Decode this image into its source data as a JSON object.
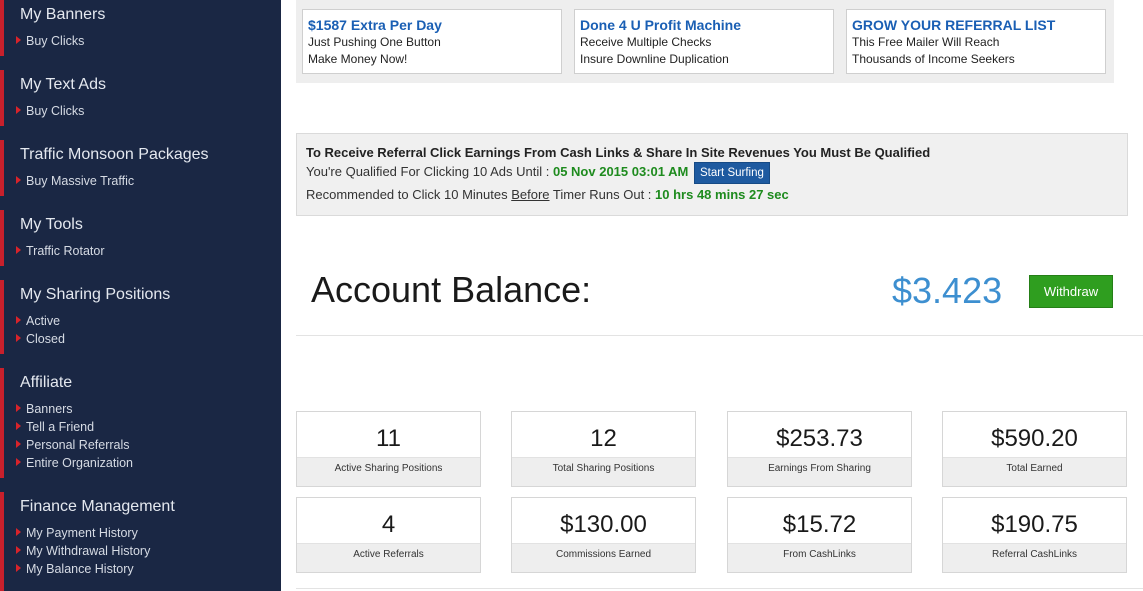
{
  "sidebar": {
    "sections": [
      {
        "title": "My Banners",
        "items": [
          "Buy Clicks"
        ]
      },
      {
        "title": "My Text Ads",
        "items": [
          "Buy Clicks"
        ]
      },
      {
        "title": "Traffic Monsoon Packages",
        "items": [
          "Buy Massive Traffic"
        ]
      },
      {
        "title": "My Tools",
        "items": [
          "Traffic Rotator"
        ]
      },
      {
        "title": "My Sharing Positions",
        "items": [
          "Active",
          "Closed"
        ]
      },
      {
        "title": "Affiliate",
        "items": [
          "Banners",
          "Tell a Friend",
          "Personal Referrals",
          "Entire Organization"
        ]
      },
      {
        "title": "Finance Management",
        "items": [
          "My Payment History",
          "My Withdrawal History",
          "My Balance History"
        ]
      }
    ]
  },
  "ads": [
    {
      "title": "$1587 Extra Per Day",
      "line1": "Just Pushing One Button",
      "line2": "Make Money Now!"
    },
    {
      "title": "Done 4 U Profit Machine",
      "line1": "Receive Multiple Checks",
      "line2": "Insure Downline Duplication"
    },
    {
      "title": "GROW YOUR REFERRAL LIST",
      "line1": "This Free Mailer Will Reach",
      "line2": "Thousands of Income Seekers"
    }
  ],
  "qualification": {
    "title": "To Receive Referral Click Earnings From Cash Links & Share In Site Revenues You Must Be Qualified",
    "qualified_prefix": "You're Qualified For Clicking 10 Ads Until :",
    "qualified_until": "05 Nov 2015 03:01 AM",
    "start_button": "Start Surfing",
    "rec_prefix": "Recommended to Click 10 Minutes",
    "rec_before": "Before",
    "rec_mid": "Timer Runs Out :",
    "rec_timer": "10 hrs 48 mins 27 sec"
  },
  "balance": {
    "label": "Account Balance:",
    "value": "$3.423",
    "withdraw_button": "Withdraw"
  },
  "stats": [
    {
      "value": "11",
      "label": "Active Sharing Positions"
    },
    {
      "value": "12",
      "label": "Total Sharing Positions"
    },
    {
      "value": "$253.73",
      "label": "Earnings From Sharing"
    },
    {
      "value": "$590.20",
      "label": "Total Earned"
    },
    {
      "value": "4",
      "label": "Active Referrals"
    },
    {
      "value": "$130.00",
      "label": "Commissions Earned"
    },
    {
      "value": "$15.72",
      "label": "From CashLinks"
    },
    {
      "value": "$190.75",
      "label": "Referral CashLinks"
    }
  ],
  "colors": {
    "sidebar_bg": "#1a2744",
    "accent_red": "#c8202c",
    "link_blue": "#1a5fb4",
    "balance_blue": "#3d8fd0",
    "qualified_green": "#1e8b1e",
    "withdraw_green": "#2f9e1f",
    "surf_button_blue": "#1e5aa0"
  },
  "icons": {
    "sidebar_bullet": "red-triangle-icon"
  }
}
